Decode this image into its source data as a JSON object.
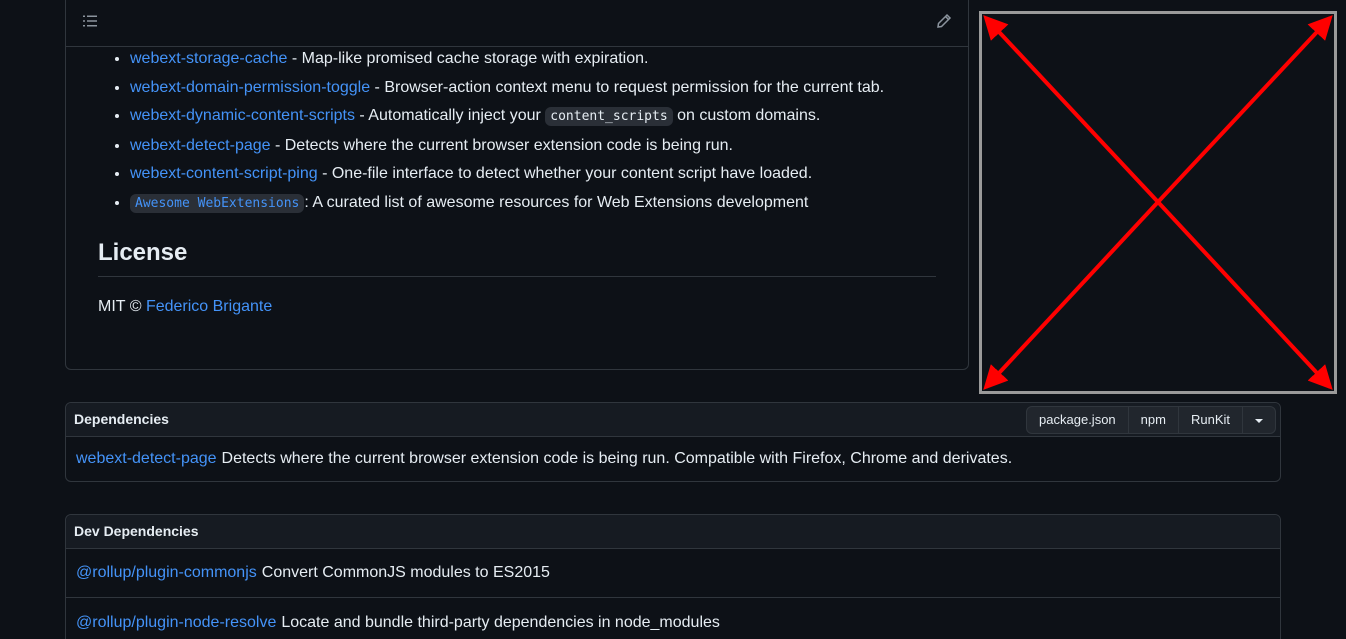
{
  "readme": {
    "links": [
      {
        "name": "webext-storage-cache",
        "pre": "",
        "post": " - Map-like promised cache storage with expiration."
      },
      {
        "name": "webext-domain-permission-toggle",
        "pre": "",
        "post": " - Browser-action context menu to request permission for the current tab."
      },
      {
        "name": "webext-dynamic-content-scripts",
        "pre": " - Automatically inject your ",
        "code": "content_scripts",
        "post": " on custom domains."
      },
      {
        "name": "webext-detect-page",
        "pre": "",
        "post": " - Detects where the current browser extension code is being run."
      },
      {
        "name": "webext-content-script-ping",
        "pre": "",
        "post": " - One-file interface to detect whether your content script have loaded."
      }
    ],
    "awesome": {
      "code": "Awesome WebExtensions",
      "post": ": A curated list of awesome resources for Web Extensions development"
    },
    "license_heading": "License",
    "license_prefix": "MIT © ",
    "license_author": "Federico Brigante"
  },
  "dependencies": {
    "title": "Dependencies",
    "buttons": [
      "package.json",
      "npm",
      "RunKit"
    ],
    "items": [
      {
        "name": "webext-detect-page",
        "desc": "Detects where the current browser extension code is being run. Compatible with Firefox, Chrome and derivates."
      }
    ]
  },
  "dev_dependencies": {
    "title": "Dev Dependencies",
    "items": [
      {
        "name": "@rollup/plugin-commonjs",
        "desc": "Convert CommonJS modules to ES2015"
      },
      {
        "name": "@rollup/plugin-node-resolve",
        "desc": "Locate and bundle third-party dependencies in node_modules"
      }
    ]
  },
  "colors": {
    "link": "#4493f8",
    "placeholder_cross": "#ff0000",
    "border": "#30363d"
  },
  "icons": {
    "toc": "list-unordered-icon",
    "edit": "pencil-icon",
    "dropdown": "triangle-down-icon"
  }
}
